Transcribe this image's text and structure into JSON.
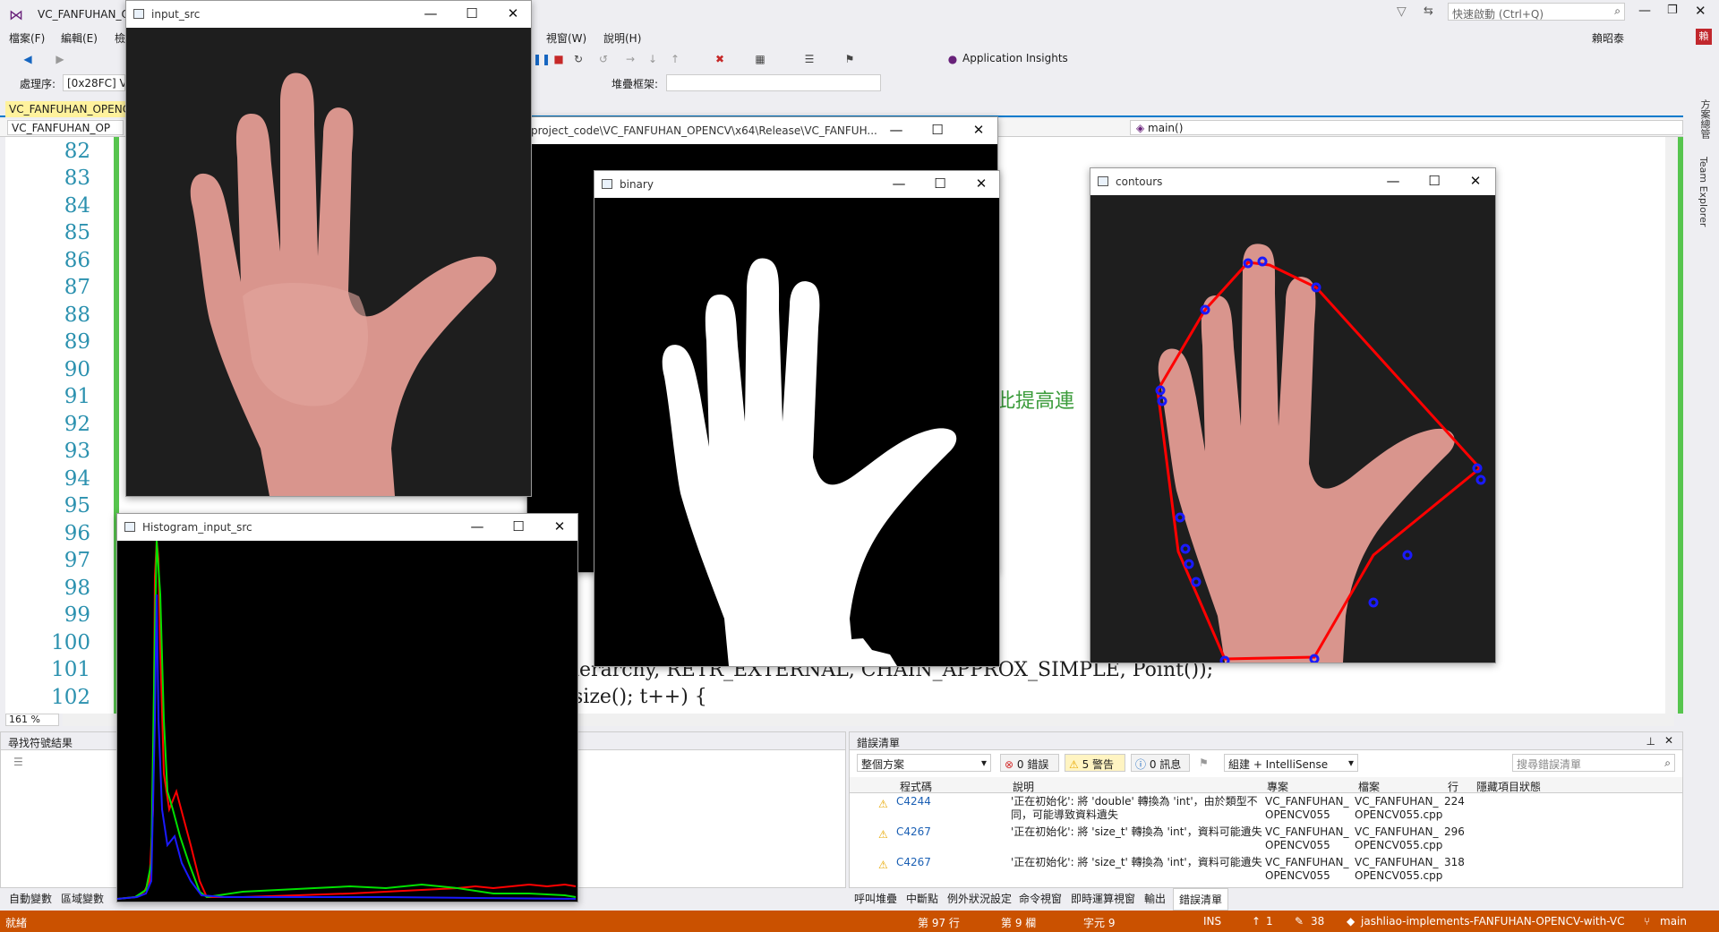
{
  "vs": {
    "window_title": "VC_FANFUHAN_O",
    "quick_launch_placeholder": "快速啟動 (Ctrl+Q)",
    "menu": [
      "檔案(F)",
      "編輯(E)",
      "檢",
      "視窗(W)",
      "說明(H)"
    ],
    "account_label": "賴昭泰",
    "account_badge": "賴",
    "process_label": "處理序:",
    "process_value": "[0x28FC] VC",
    "stack_frame_label": "堆疊框架:",
    "app_insights": "Application Insights",
    "doc_tab": "VC_FANFUHAN_OPENC",
    "nav_project": "VC_FANFUHAN_OP",
    "nav_function": "main()",
    "zoom": "161 %",
    "line_numbers": [
      "82",
      "83",
      "84",
      "85",
      "86",
      "87",
      "88",
      "89",
      "90",
      "91",
      "92",
      "93",
      "94",
      "95",
      "96",
      "97",
      "98",
      "99",
      "100",
      "101",
      "102"
    ],
    "code_comment_fragment": "此提高連",
    "code_line_101": "ierarchy, RETR_EXTERNAL, CHAIN_APPROX_SIMPLE, Point());",
    "code_line_102": "size(); t++) {",
    "console_title": "project_code\\VC_FANFUHAN_OPENCV\\x64\\Release\\VC_FANFUH...",
    "vertical_tabs": [
      "方案總管",
      "Team Explorer"
    ]
  },
  "windows": {
    "input_src": "input_src",
    "histogram": "Histogram_input_src",
    "binary": "binary",
    "contours": "contours"
  },
  "find_panel": {
    "title": "尋找符號結果"
  },
  "error_list": {
    "title": "錯誤清單",
    "scope": "整個方案",
    "errors": "0 錯誤",
    "warnings": "5 警告",
    "messages": "0 訊息",
    "build_filter": "組建 + IntelliSense",
    "search_placeholder": "搜尋錯誤清單",
    "columns": [
      "程式碼",
      "說明",
      "專案",
      "檔案",
      "行",
      "隱藏項目狀態"
    ],
    "rows": [
      {
        "code": "C4244",
        "desc1": "'正在初始化': 將 'double' 轉換為 'int'，由於類型不",
        "desc2": "同，可能導致資料遺失",
        "project1": "VC_FANFUHAN_",
        "project2": "OPENCV055",
        "file1": "VC_FANFUHAN_",
        "file2": "OPENCV055.cpp",
        "line": "224"
      },
      {
        "code": "C4267",
        "desc1": "'正在初始化': 將 'size_t' 轉換為 'int'，資料可能遺失",
        "desc2": "",
        "project1": "VC_FANFUHAN_",
        "project2": "OPENCV055",
        "file1": "VC_FANFUHAN_",
        "file2": "OPENCV055.cpp",
        "line": "296"
      },
      {
        "code": "C4267",
        "desc1": "'正在初始化': 將 'size_t' 轉換為 'int'，資料可能遺失",
        "desc2": "",
        "project1": "VC_FANFUHAN_",
        "project2": "OPENCV055",
        "file1": "VC_FANFUHAN_",
        "file2": "OPENCV055.cpp",
        "line": "318"
      }
    ]
  },
  "bottom_tabs_left": [
    "自動變數",
    "區域變數"
  ],
  "bottom_tabs_right": [
    "呼叫堆疊",
    "中斷點",
    "例外狀況設定",
    "命令視窗",
    "即時運算視窗",
    "輸出",
    "錯誤清單"
  ],
  "status": {
    "ready": "就緒",
    "line": "第 97 行",
    "col": "第 9 欄",
    "char": "字元 9",
    "ins": "INS",
    "up": "1",
    "edits": "38",
    "repo": "jashliao-implements-FANFUHAN-OPENCV-with-VC",
    "branch": "main"
  },
  "colors": {
    "status_bar": "#ca5100",
    "accent": "#007acc",
    "line_number": "#2b91af",
    "hull": "#ff0000",
    "contour_points": "#1a1aff"
  }
}
